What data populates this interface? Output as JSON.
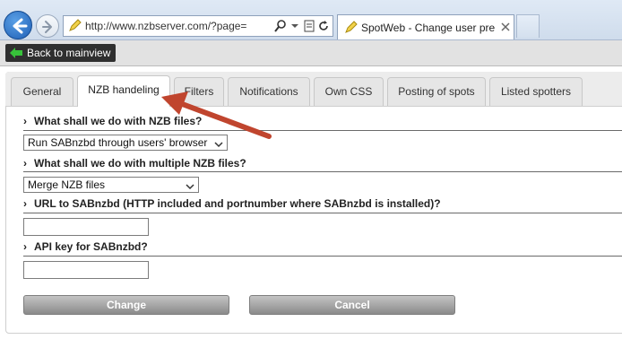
{
  "browser": {
    "address": "http://www.nzbserver.com/?page=edit",
    "tab_title": "SpotWeb - Change user pre..."
  },
  "toolbar": {
    "back_label": "Back to mainview"
  },
  "tabs": [
    {
      "label": "General"
    },
    {
      "label": "NZB handeling"
    },
    {
      "label": "Filters"
    },
    {
      "label": "Notifications"
    },
    {
      "label": "Own CSS"
    },
    {
      "label": "Posting of spots"
    },
    {
      "label": "Listed spotters"
    }
  ],
  "sections": {
    "nzb_files": {
      "heading": "What shall we do with NZB files?",
      "selected": "Run SABnzbd through users' browser"
    },
    "multiple_nzb": {
      "heading": "What shall we do with multiple NZB files?",
      "selected": "Merge NZB files"
    },
    "sab_url": {
      "heading": "URL to SABnzbd (HTTP included and portnumber where SABnzbd is installed)?",
      "value": ""
    },
    "api_key": {
      "heading": "API key for SABnzbd?",
      "value": ""
    }
  },
  "buttons": {
    "change": "Change",
    "cancel": "Cancel"
  },
  "colors": {
    "annotation_arrow": "#c0452e",
    "back_button_bg": "#2f2f2f",
    "back_icon": "#37c23a"
  }
}
